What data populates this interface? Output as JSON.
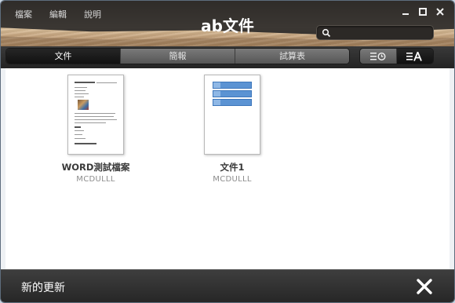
{
  "app": {
    "title": "ab文件",
    "menu": [
      "檔案",
      "編輯",
      "說明"
    ]
  },
  "search": {
    "placeholder": ""
  },
  "tabs": [
    {
      "label": "文件",
      "active": true
    },
    {
      "label": "簡報",
      "active": false
    },
    {
      "label": "試算表",
      "active": false
    }
  ],
  "view_toggle": {
    "options": [
      "list-by-time-icon",
      "sort-by-name-icon"
    ],
    "active": "sort-by-name-icon"
  },
  "documents": [
    {
      "name": "WORD測試檔案",
      "author": "MCDULLL",
      "thumbnail": "word-document-thumbnail"
    },
    {
      "name": "文件1",
      "author": "MCDULLL",
      "thumbnail": "table-document-thumbnail"
    }
  ],
  "bottom_bar": {
    "label": "新的更新"
  },
  "colors": {
    "accent_blue": "#5b93d3",
    "header_dark": "#2f2c29",
    "wood": "#c4a27c"
  }
}
